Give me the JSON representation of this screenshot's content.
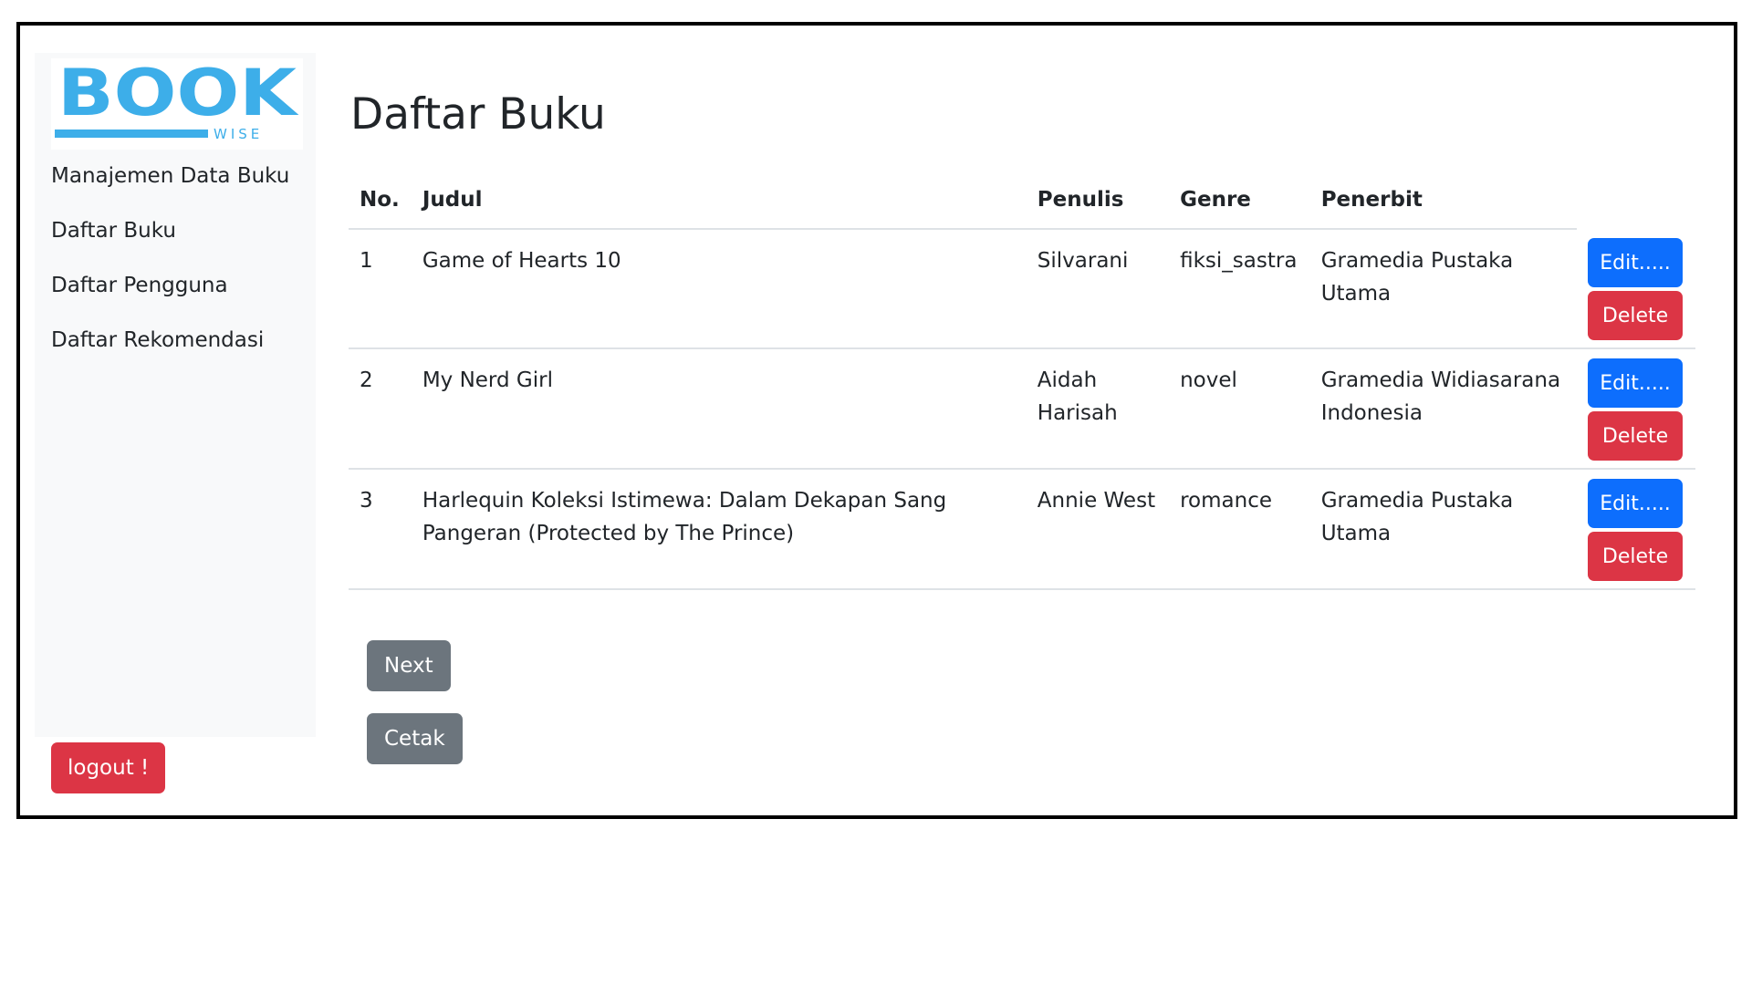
{
  "sidebar": {
    "logo": {
      "word": "BOOK",
      "sub": "WISE",
      "color": "#3daee9"
    },
    "nav": [
      {
        "label": "Manajemen Data Buku"
      },
      {
        "label": "Daftar Buku"
      },
      {
        "label": "Daftar Pengguna"
      },
      {
        "label": "Daftar Rekomendasi"
      }
    ],
    "logout_label": "logout !"
  },
  "main": {
    "title": "Daftar Buku",
    "table": {
      "headers": {
        "no": "No.",
        "judul": "Judul",
        "penulis": "Penulis",
        "genre": "Genre",
        "penerbit": "Penerbit"
      },
      "rows": [
        {
          "no": "1",
          "judul": "Game of Hearts 10",
          "penulis": "Silvarani",
          "genre": "fiksi_sastra",
          "penerbit": "Gramedia Pustaka Utama",
          "edit_label": "Edit.....",
          "delete_label": "Delete"
        },
        {
          "no": "2",
          "judul": "My Nerd Girl",
          "penulis": "Aidah Harisah",
          "genre": "novel",
          "penerbit": "Gramedia Widiasarana Indonesia",
          "edit_label": "Edit.....",
          "delete_label": "Delete"
        },
        {
          "no": "3",
          "judul": "Harlequin Koleksi Istimewa: Dalam Dekapan Sang Pangeran (Protected by The Prince)",
          "penulis": "Annie West",
          "genre": "romance",
          "penerbit": "Gramedia Pustaka Utama",
          "edit_label": "Edit.....",
          "delete_label": "Delete"
        }
      ]
    },
    "next_label": "Next",
    "print_label": "Cetak"
  },
  "colors": {
    "primary": "#0d6efd",
    "danger": "#dc3545",
    "secondary": "#6c757d",
    "sidebar_bg": "#f8f9fa"
  }
}
